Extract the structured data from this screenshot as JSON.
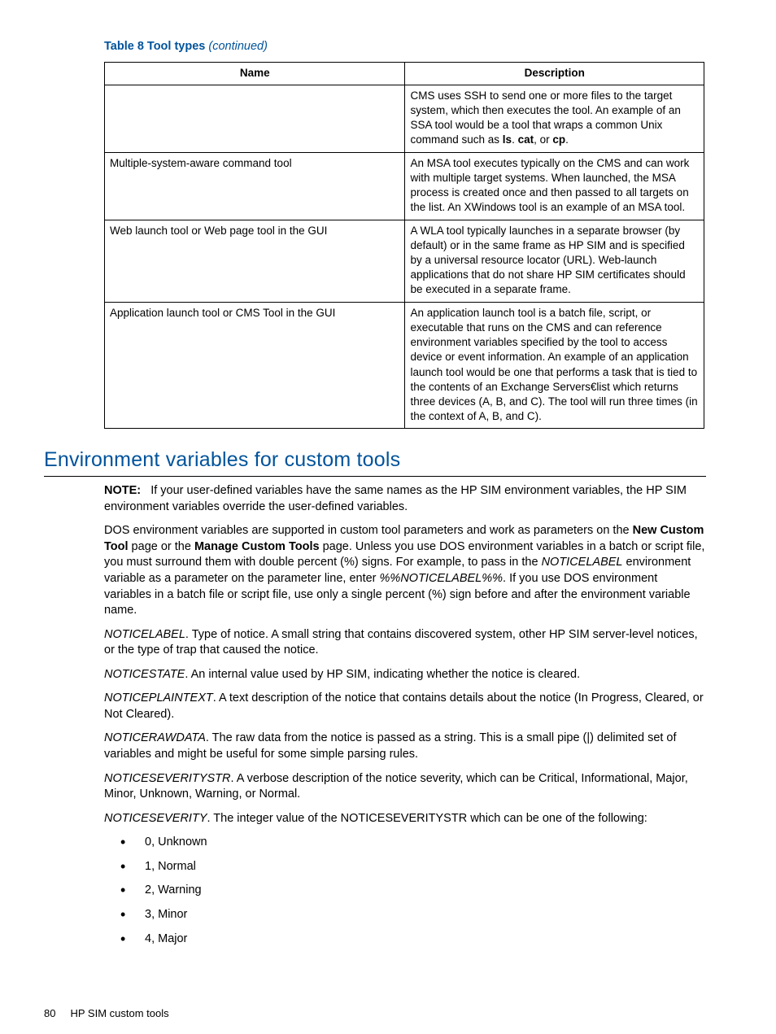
{
  "table": {
    "caption_main": "Table 8 Tool types",
    "caption_suffix": "(continued)",
    "headers": {
      "name": "Name",
      "description": "Description"
    },
    "rows": [
      {
        "name": "",
        "desc_prefix": "CMS uses SSH to send one or more files to the target system, which then executes the tool. An example of an SSA tool would be a tool that wraps a common Unix command such as ",
        "bold1": "ls",
        "mid1": ". ",
        "bold2": "cat",
        "mid2": ", or ",
        "bold3": "cp",
        "suffix": "."
      },
      {
        "name": "Multiple-system-aware command tool",
        "desc": "An MSA tool executes typically on the CMS and can work with multiple target systems. When launched, the MSA process is created once and then passed to all targets on the list. An XWindows tool is an example of an MSA tool."
      },
      {
        "name": "Web launch tool or Web page tool in the GUI",
        "desc": "A WLA tool typically launches in a separate browser (by default) or in the same frame as HP SIM and is specified by a universal resource locator (URL). Web-launch applications that do not share HP SIM certificates should be executed in a separate frame."
      },
      {
        "name": "Application launch tool or CMS Tool in the GUI",
        "desc": "An application launch tool is a batch file, script, or executable that runs on the CMS and can reference environment variables specified by the tool to access device or event information. An example of an application launch tool would be one that performs a task that is tied to the contents of an Exchange Servers€list which returns three devices (A, B, and C). The tool will run three times (in the context of A, B, and C)."
      }
    ]
  },
  "section_heading": "Environment variables for custom tools",
  "note": {
    "label": "NOTE:",
    "text": "If your user-defined variables have the same names as the HP SIM environment variables, the HP SIM environment variables override the user-defined variables."
  },
  "dos_para": {
    "p1": "DOS environment variables are supported in custom tool parameters and work as parameters on the ",
    "b1": "New Custom Tool",
    "p2": " page or the ",
    "b2": "Manage Custom Tools",
    "p3": " page. Unless you use DOS environment variables in a batch or script file, you must surround them with double percent (%) signs. For example, to pass in the ",
    "i1": "NOTICELABEL",
    "p4": " environment variable as a parameter on the parameter line, enter ",
    "i2": "%%NOTICELABEL%%",
    "p5": ". If you use DOS environment variables in a batch file or script file, use only a single percent (%) sign before and after the environment variable name."
  },
  "vars": {
    "noticelabel": {
      "name": "NOTICELABEL",
      "text": ". Type of notice. A small string that contains discovered system, other HP SIM server-level notices, or the type of trap that caused the notice."
    },
    "noticestate": {
      "name": "NOTICESTATE",
      "text": ". An internal value used by HP SIM, indicating whether the notice is cleared."
    },
    "noticeplaintext": {
      "name": "NOTICEPLAINTEXT",
      "text": ". A text description of the notice that contains details about the notice (In Progress, Cleared, or Not Cleared)."
    },
    "noticerawdata": {
      "name": "NOTICERAWDATA",
      "text": ". The raw data from the notice is passed as a string. This is a small pipe (|) delimited set of variables and might be useful for some simple parsing rules."
    },
    "noticeseveritystr": {
      "name": "NOTICESEVERITYSTR",
      "text": ". A verbose description of the notice severity, which can be Critical, Informational, Major, Minor, Unknown, Warning, or Normal."
    },
    "noticeseverity": {
      "name": "NOTICESEVERITY",
      "text": ". The integer value of the NOTICESEVERITYSTR which can be one of the following:"
    }
  },
  "severity_list": [
    "0, Unknown",
    "1, Normal",
    "2, Warning",
    "3, Minor",
    "4, Major"
  ],
  "footer": {
    "page": "80",
    "section": "HP SIM custom tools"
  }
}
